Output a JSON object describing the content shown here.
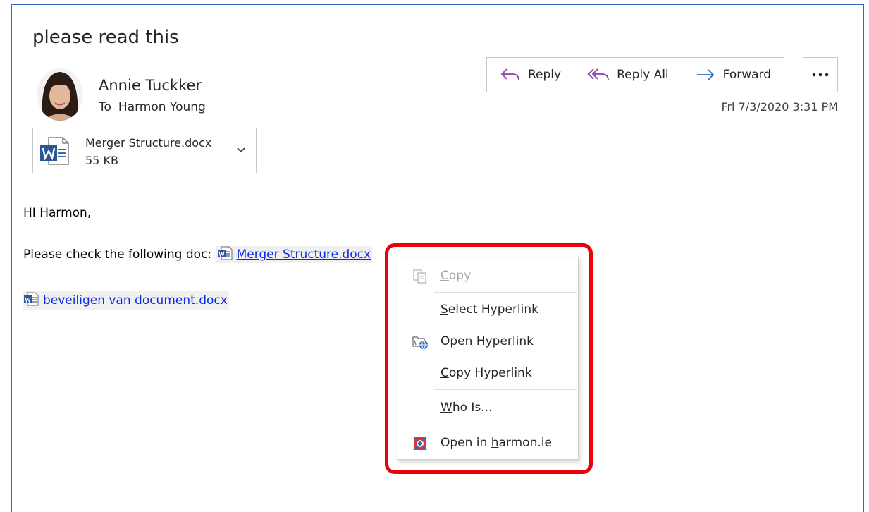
{
  "message": {
    "subject": "please read this",
    "sender": "Annie Tuckker",
    "to_label": "To",
    "recipient": "Harmon Young",
    "timestamp": "Fri 7/3/2020 3:31 PM"
  },
  "attachment": {
    "name": "Merger Structure.docx",
    "size": "55 KB",
    "icon": "word-doc-icon"
  },
  "actions": {
    "reply": "Reply",
    "reply_all": "Reply All",
    "forward": "Forward",
    "more": "..."
  },
  "body": {
    "greeting": "HI Harmon,",
    "line1_prefix": "Please check the following doc:",
    "link1": "Merger Structure.docx",
    "link2": "beveiligen van document.docx"
  },
  "context_menu": {
    "copy": {
      "pre": "",
      "ul": "C",
      "post": "opy"
    },
    "select_hyperlink": {
      "pre": "",
      "ul": "S",
      "post": "elect Hyperlink"
    },
    "open_hyperlink": {
      "pre": "",
      "ul": "O",
      "post": "pen Hyperlink"
    },
    "copy_hyperlink": {
      "pre": "",
      "ul": "C",
      "post": "opy Hyperlink"
    },
    "who_is": {
      "pre": "",
      "ul": "W",
      "post": "ho Is..."
    },
    "open_in_harmonie": {
      "pre": "Open in ",
      "ul": "h",
      "post": "armon.ie"
    }
  },
  "colors": {
    "link": "#0b2de8",
    "highlight": "#e8000b",
    "accent_reply": "#8a3fa8",
    "accent_forward": "#2f6bbd"
  }
}
